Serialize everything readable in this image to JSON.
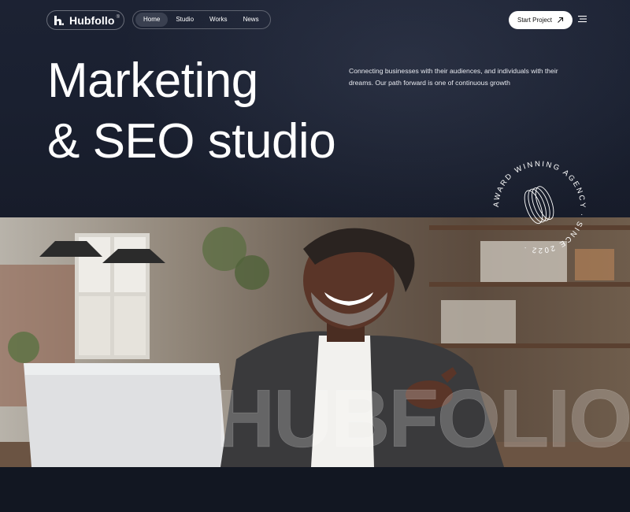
{
  "brand": {
    "name": "Hubfollo",
    "reg_mark": "®",
    "logo_icon": "hubfollo-logo-icon"
  },
  "nav": {
    "items": [
      {
        "label": "Home",
        "active": true
      },
      {
        "label": "Studio",
        "active": false
      },
      {
        "label": "Works",
        "active": false
      },
      {
        "label": "News",
        "active": false
      }
    ]
  },
  "cta": {
    "label": "Start Project",
    "icon": "arrow-up-right-icon"
  },
  "menu": {
    "icon": "hamburger-menu-icon"
  },
  "hero": {
    "headline_line1": "Marketing",
    "headline_line2": "& SEO studio",
    "tagline": "Connecting businesses with their audiences, and individuals with their dreams. Our path forward is one of continuous growth"
  },
  "badge": {
    "ring_text": "AWARD WINNING AGENCY · SINCE 2022 ·",
    "icon": "rings-icon"
  },
  "photo": {
    "watermark": "HUBFOLIO"
  },
  "colors": {
    "hero_bg": "#1a2030",
    "accent_white": "#ffffff",
    "nav_active": "#3a4050"
  }
}
